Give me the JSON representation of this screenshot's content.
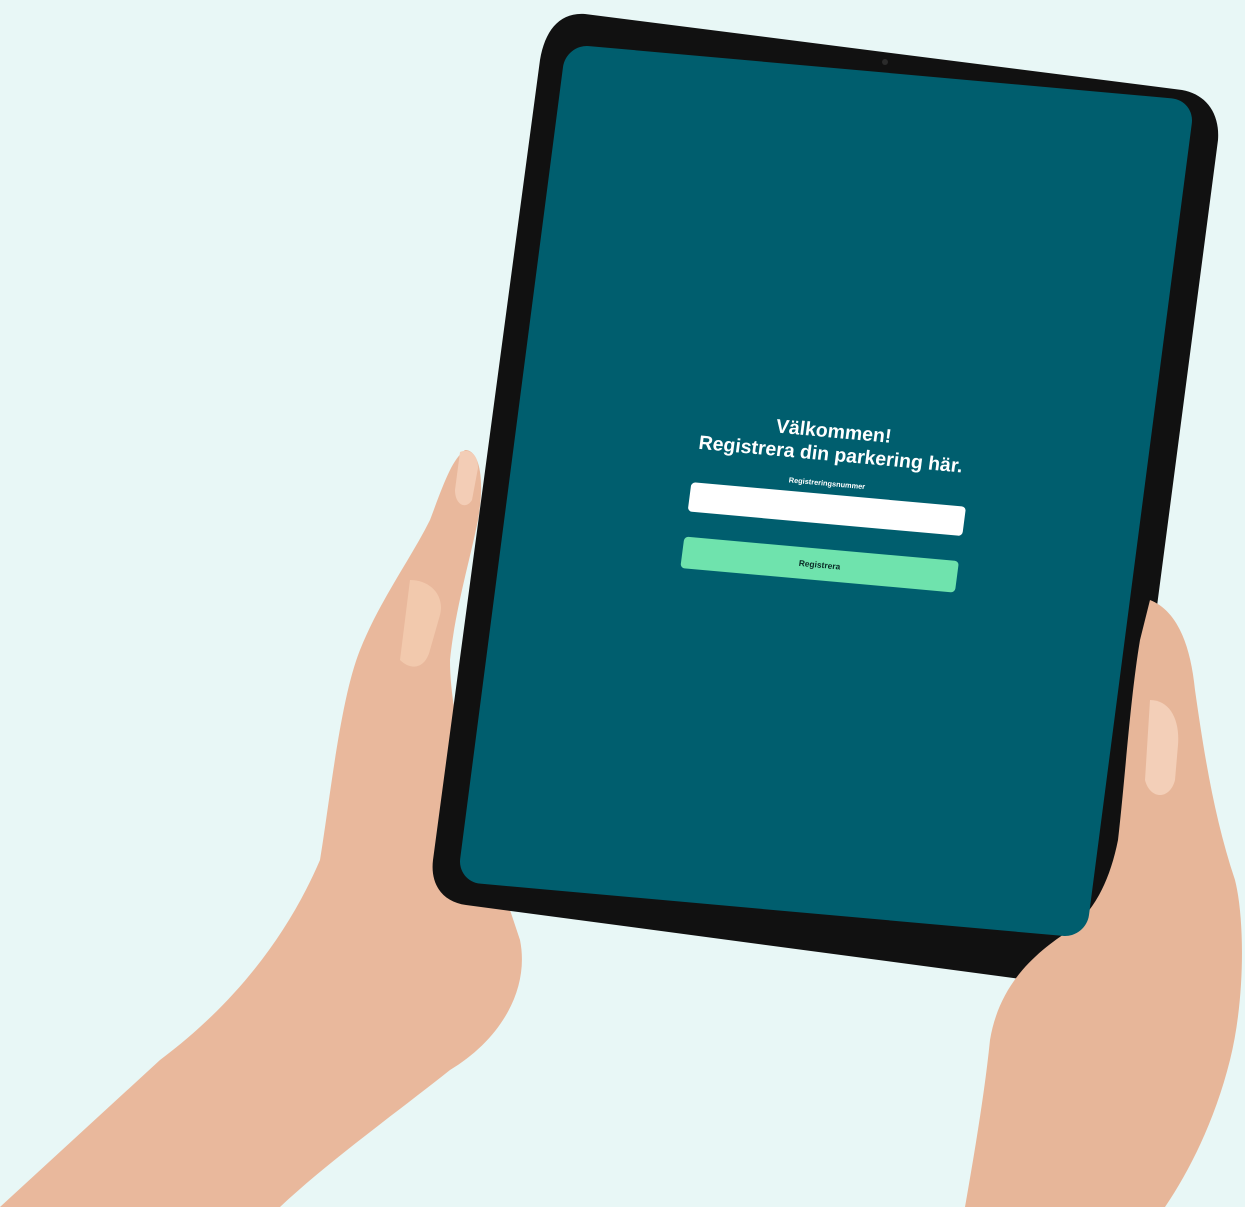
{
  "app": {
    "welcome_line1": "Välkommen!",
    "welcome_line2": "Registrera din parkering här."
  },
  "form": {
    "registration_label": "Registreringsnummer",
    "registration_value": "",
    "registration_placeholder": "",
    "submit_label": "Registrera"
  },
  "colors": {
    "page_background": "#e8f7f6",
    "screen_background": "#005e6e",
    "button_background": "#6fe3ad",
    "input_background": "#ffffff",
    "device_frame": "#111111"
  }
}
